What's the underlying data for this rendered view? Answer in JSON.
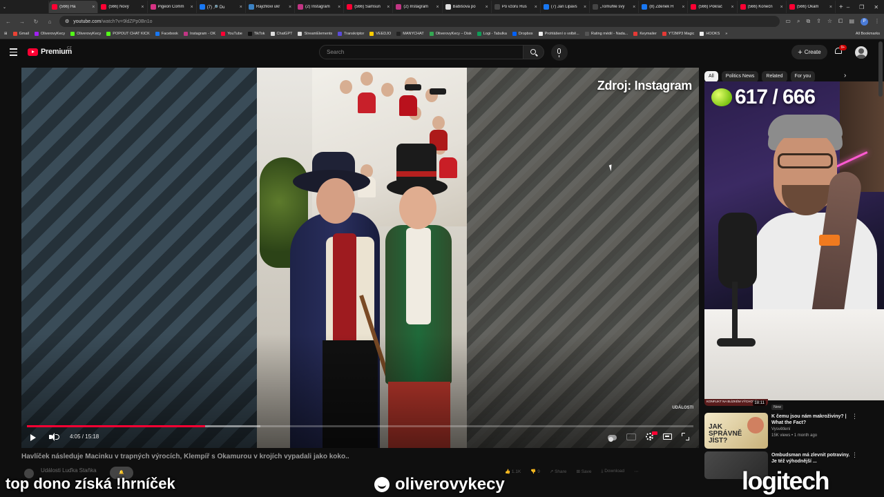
{
  "browser": {
    "tabs": [
      {
        "label": "(566) Ha",
        "color": "#ff0033",
        "active": true
      },
      {
        "label": "(566) Nový",
        "color": "#ff0033"
      },
      {
        "label": "Pigeon Comm",
        "color": "#d63384"
      },
      {
        "label": "(7) 🔎 Du",
        "color": "#1877f2"
      },
      {
        "label": "Rajchlovi ukr",
        "color": "#3b82c4"
      },
      {
        "label": "(2) Instagram",
        "color": "#c13584"
      },
      {
        "label": "(566) Samsun",
        "color": "#ff0033"
      },
      {
        "label": "(2) Instagram",
        "color": "#c13584"
      },
      {
        "label": "Babišova po",
        "color": "#e0e0e0"
      },
      {
        "label": "Po vzoru Rus",
        "color": "#444"
      },
      {
        "label": "(7) Jan Lipavs",
        "color": "#1877f2"
      },
      {
        "label": "„Tomuhle svý",
        "color": "#444"
      },
      {
        "label": "(8) Zdenek H",
        "color": "#1877f2"
      },
      {
        "label": "(566) Pokrač",
        "color": "#ff0033"
      },
      {
        "label": "(566) Konečn",
        "color": "#ff0033"
      },
      {
        "label": "(566) Okam",
        "color": "#ff0033"
      }
    ],
    "new_tab": "+",
    "url_host": "youtube.com",
    "url_path": "/watch?v=9ldZPp0Bn1o",
    "bookmarks": [
      {
        "label": "Gmail",
        "color": "#ea4335"
      },
      {
        "label": "OliverovyKecy",
        "color": "#a020f0"
      },
      {
        "label": "OliverovyKecy",
        "color": "#53fc18"
      },
      {
        "label": "POPOUT CHAT KICK",
        "color": "#53fc18"
      },
      {
        "label": "Facebook",
        "color": "#1877f2"
      },
      {
        "label": "Instagram - OK",
        "color": "#c13584"
      },
      {
        "label": "YouTube",
        "color": "#ff0033"
      },
      {
        "label": "TikTok",
        "color": "#111"
      },
      {
        "label": "ChatGPT",
        "color": "#ddd"
      },
      {
        "label": "StreamElements",
        "color": "#ddd"
      },
      {
        "label": "Transkriptor",
        "color": "#5b4bdb"
      },
      {
        "label": "VEEDJO",
        "color": "#ffcc00"
      },
      {
        "label": "MANYCHAT",
        "color": "#222"
      },
      {
        "label": "OliverovyKecy – Disk",
        "color": "#34a853"
      },
      {
        "label": "Logi - Tabulka",
        "color": "#0f9d58"
      },
      {
        "label": "Dropbox",
        "color": "#0061ff"
      },
      {
        "label": "Prohlášení o volbě...",
        "color": "#eee"
      },
      {
        "label": "Rating médií - Nada...",
        "color": "#555"
      },
      {
        "label": "Keymailer",
        "color": "#e53935"
      },
      {
        "label": "YT2MP3 Magic",
        "color": "#e53935"
      },
      {
        "label": "HOOKS",
        "color": "#eee"
      }
    ],
    "all_bookmarks": "All Bookmarks"
  },
  "youtube": {
    "logo_word": "Premium",
    "country": "CZ",
    "search_placeholder": "Search",
    "create_label": "Create",
    "notif_count": "9+"
  },
  "player": {
    "source_watermark": "Zdroj: Instagram",
    "corner_mark": "UDÁLOSTI",
    "time": "4:05 / 15:18",
    "progress_fraction": 0.267,
    "buffer_fraction": 0.35,
    "accent": "#ff0033"
  },
  "video": {
    "title": "Havlíček následuje Macinku v trapných výrocích, Klempíř s Okamurou v krojích vypadali jako koko..",
    "channel": "Události Luďka Staňka",
    "likes": "1.1K",
    "dislike_count": "9",
    "share": "Share",
    "save": "Save",
    "download": "Download"
  },
  "chips": [
    "All",
    "Politics News",
    "Related",
    "For you"
  ],
  "overlay": {
    "counter": "617 / 666"
  },
  "recommendations": [
    {
      "title": "KONFLIKT NA BLÍZKÉM VÝCHODĚ",
      "duration": "18:11",
      "badge": "New"
    },
    {
      "title": "K čemu jsou nám makroživiny? | What the Fact?",
      "channel": "Vysvětlení",
      "meta": "15K views • 1 month ago",
      "thumb_text": "JAK SPRÁVNĚ JÍST?"
    },
    {
      "title": "Ombudsman má zlevnit potraviny. Je též výhodnější ...",
      "channel": "",
      "meta": ""
    }
  ],
  "captions": {
    "left": "top dono získá !hrníček",
    "center": "oliverovykecy",
    "brand": "logitech"
  }
}
